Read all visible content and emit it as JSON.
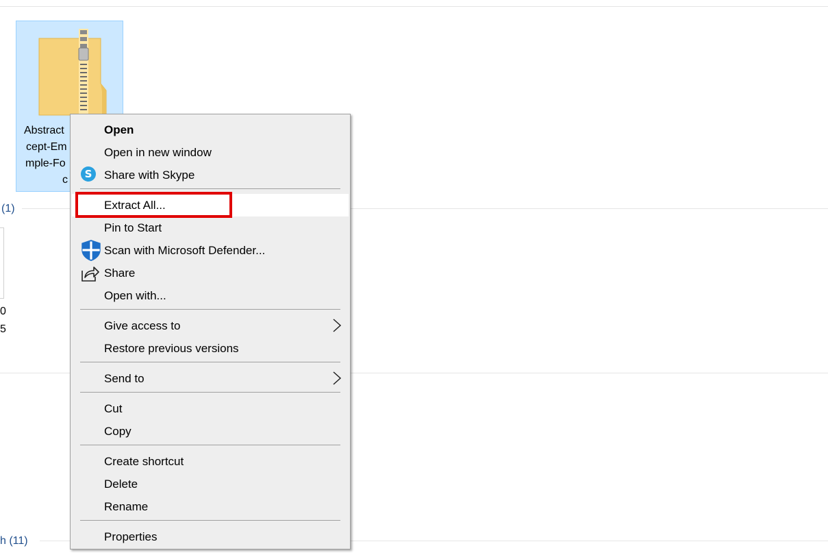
{
  "explorer": {
    "selected_item": {
      "name_lines": [
        "Abstract",
        "cept-Em",
        "mple-Fo",
        "c"
      ]
    },
    "group_labels": {
      "group_1": "(1)",
      "group_2": "h (11)"
    },
    "partial_item_text": [
      "0",
      "5"
    ]
  },
  "context_menu": {
    "items": [
      {
        "id": "open",
        "label": "Open"
      },
      {
        "id": "open-new-window",
        "label": "Open in new window"
      },
      {
        "id": "share-skype",
        "label": "Share with Skype",
        "icon": "skype-icon"
      },
      {
        "id": "extract-all",
        "label": "Extract All..."
      },
      {
        "id": "pin-start",
        "label": "Pin to Start"
      },
      {
        "id": "scan-defender",
        "label": "Scan with Microsoft Defender...",
        "icon": "defender-shield-icon"
      },
      {
        "id": "share",
        "label": "Share",
        "icon": "share-icon"
      },
      {
        "id": "open-with",
        "label": "Open with..."
      },
      {
        "id": "give-access",
        "label": "Give access to",
        "submenu": true
      },
      {
        "id": "restore-versions",
        "label": "Restore previous versions"
      },
      {
        "id": "send-to",
        "label": "Send to",
        "submenu": true
      },
      {
        "id": "cut",
        "label": "Cut"
      },
      {
        "id": "copy",
        "label": "Copy"
      },
      {
        "id": "create-shortcut",
        "label": "Create shortcut"
      },
      {
        "id": "delete",
        "label": "Delete"
      },
      {
        "id": "rename",
        "label": "Rename"
      },
      {
        "id": "properties",
        "label": "Properties"
      }
    ],
    "highlighted_item": "extract-all"
  },
  "colors": {
    "selection_bg": "#cce8ff",
    "menu_bg": "#eeeeee",
    "highlight_border": "#e00000",
    "group_label": "#1f4e8c"
  }
}
